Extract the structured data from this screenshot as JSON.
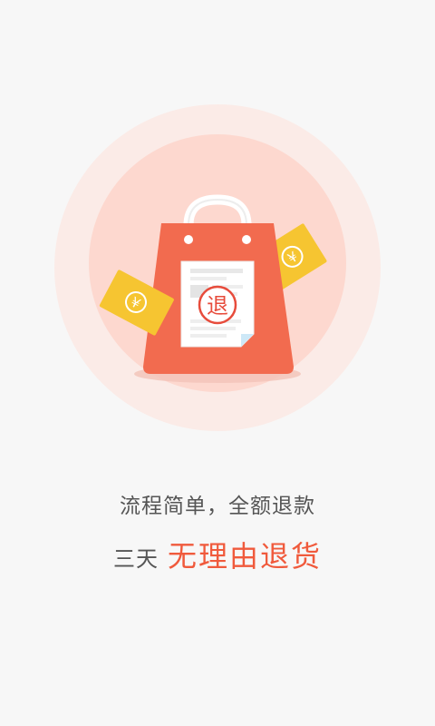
{
  "hero": {
    "stamp_char": "退",
    "coin_symbol": "¥",
    "colors": {
      "background": "#f7f7f7",
      "circle_outer": "#fbe9e5",
      "circle_inner": "#fdd6cc",
      "bag": "#f26b4f",
      "ticket": "#f6c531",
      "stamp": "#e74c3c"
    }
  },
  "content": {
    "subtitle": "流程简单，全额退款",
    "headline_prefix": "三天",
    "headline_highlight": "无理由退货"
  }
}
